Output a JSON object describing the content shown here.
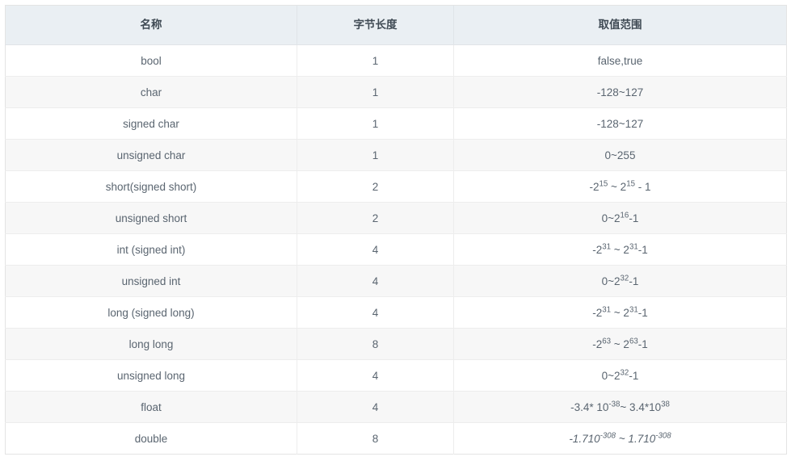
{
  "table": {
    "name": "c-data-types-table",
    "columns": [
      {
        "key": "name",
        "label": "名称"
      },
      {
        "key": "bytes",
        "label": "字节长度"
      },
      {
        "key": "range",
        "label": "取值范围"
      }
    ],
    "rows": [
      {
        "name": "bool",
        "bytes": "1",
        "range_text": "false,true",
        "range_html": "false,true",
        "italic": false
      },
      {
        "name": "char",
        "bytes": "1",
        "range_text": "-128~127",
        "range_html": "-128~127",
        "italic": false
      },
      {
        "name": "signed char",
        "bytes": "1",
        "range_text": "-128~127",
        "range_html": "-128~127",
        "italic": false
      },
      {
        "name": "unsigned char",
        "bytes": "1",
        "range_text": "0~255",
        "range_html": "0~255",
        "italic": false
      },
      {
        "name": "short(signed short)",
        "bytes": "2",
        "range_text": "-2^15 ~ 2^15 - 1",
        "range_html": "-2<sup>15</sup> ~ 2<sup>15</sup> - 1",
        "italic": false
      },
      {
        "name": "unsigned short",
        "bytes": "2",
        "range_text": "0~2^16-1",
        "range_html": "0~2<sup>16</sup>-1",
        "italic": false
      },
      {
        "name": "int (signed int)",
        "bytes": "4",
        "range_text": "-2^31 ~ 2^31-1",
        "range_html": "-2<sup>31</sup> ~ 2<sup>31</sup>-1",
        "italic": false
      },
      {
        "name": "unsigned int",
        "bytes": "4",
        "range_text": "0~2^32-1",
        "range_html": "0~2<sup>32</sup>-1",
        "italic": false
      },
      {
        "name": "long (signed long)",
        "bytes": "4",
        "range_text": "-2^31 ~ 2^31-1",
        "range_html": "-2<sup>31</sup> ~ 2<sup>31</sup>-1",
        "italic": false
      },
      {
        "name": "long long",
        "bytes": "8",
        "range_text": "-2^63 ~ 2^63-1",
        "range_html": "-2<sup>63</sup> ~ 2<sup>63</sup>-1",
        "italic": false
      },
      {
        "name": "unsigned long",
        "bytes": "4",
        "range_text": "0~2^32-1",
        "range_html": "0~2<sup>32</sup>-1",
        "italic": false
      },
      {
        "name": "float",
        "bytes": "4",
        "range_text": "-3.4* 10^-38~ 3.4*10^38",
        "range_html": "-3.4* 10<sup>-38</sup>~ 3.4*10<sup>38</sup>",
        "italic": false
      },
      {
        "name": "double",
        "bytes": "8",
        "range_text": "-1.710^-308 ~ 1.710^-308",
        "range_html": "-1.710<sup>-308</sup> ~ 1.710<sup>-308</sup>",
        "italic": true
      }
    ]
  },
  "colors": {
    "header_background": "#eaeff3",
    "header_text": "#3f4a54",
    "body_text": "#5a6570",
    "row_stripe": "#f7f7f7",
    "row_plain": "#ffffff",
    "border": "#ededed"
  }
}
